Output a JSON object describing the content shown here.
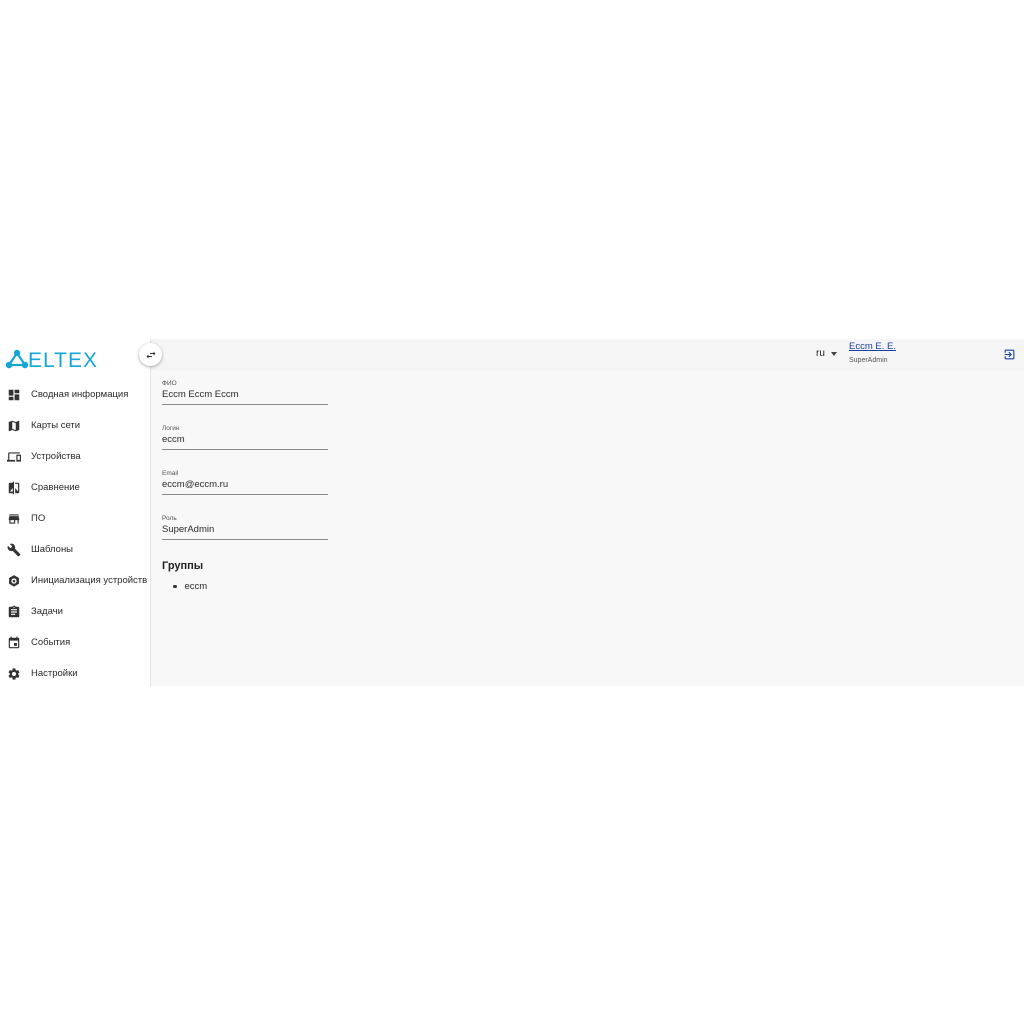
{
  "brand": {
    "logo_text": "ELTEX",
    "logo_color": "#14a6d4"
  },
  "sidebar": {
    "items": [
      {
        "label": "Сводная информация",
        "icon": "dashboard-icon"
      },
      {
        "label": "Карты сети",
        "icon": "map-icon"
      },
      {
        "label": "Устройства",
        "icon": "devices-icon"
      },
      {
        "label": "Сравнение",
        "icon": "compare-icon"
      },
      {
        "label": "ПО",
        "icon": "store-icon"
      },
      {
        "label": "Шаблоны",
        "icon": "wrench-icon"
      },
      {
        "label": "Инициализация устройств",
        "icon": "init-icon"
      },
      {
        "label": "Задачи",
        "icon": "clipboard-icon"
      },
      {
        "label": "События",
        "icon": "calendar-icon"
      },
      {
        "label": "Настройки",
        "icon": "gear-icon"
      }
    ]
  },
  "header": {
    "language": "ru",
    "user_name": "Eccm E. E.",
    "user_role": "SuperAdmin"
  },
  "profile": {
    "fields": [
      {
        "label": "ФИО",
        "value": "Eccm Eccm Eccm"
      },
      {
        "label": "Логин",
        "value": "eccm"
      },
      {
        "label": "Email",
        "value": "eccm@eccm.ru"
      },
      {
        "label": "Роль",
        "value": "SuperAdmin"
      }
    ],
    "groups_title": "Группы",
    "groups": [
      "eccm"
    ]
  }
}
